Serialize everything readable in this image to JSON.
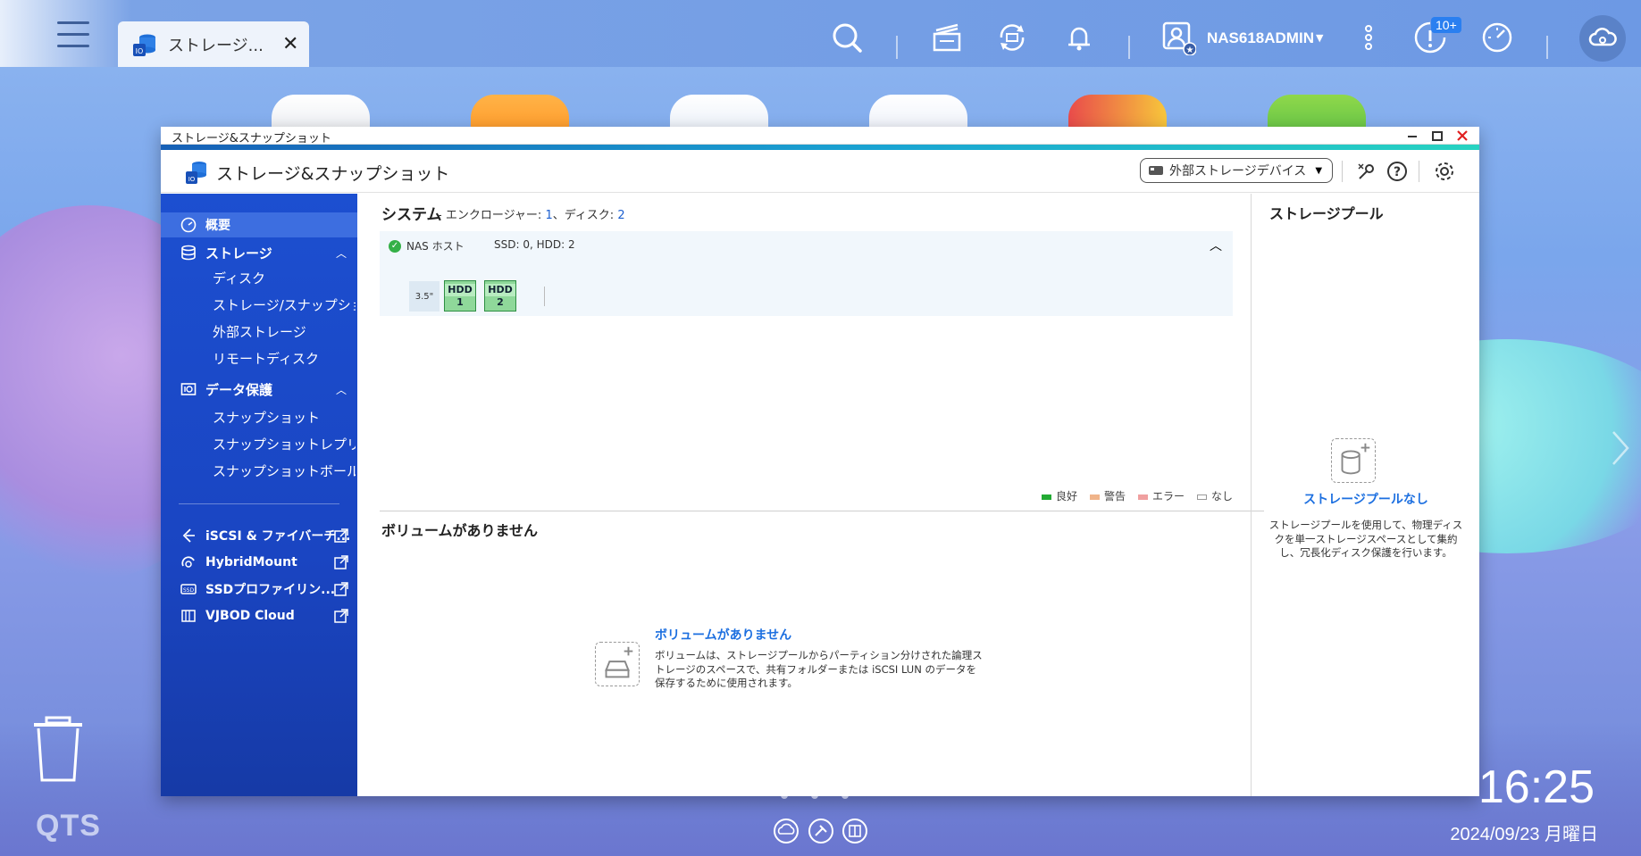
{
  "taskbar": {
    "tab_label": "ストレージ...",
    "tab_close": "✕",
    "user_name": "NAS618ADMIN",
    "notification_badge": "10+"
  },
  "window": {
    "title": "ストレージ&スナップショット",
    "app_name": "ストレージ&スナップショット",
    "external_device_dropdown": "外部ストレージデバイス"
  },
  "sidebar": {
    "overview": "概要",
    "storage": "ストレージ",
    "storage_items": [
      "ディスク",
      "ストレージ/スナップショ...",
      "外部ストレージ",
      "リモートディスク"
    ],
    "data_protection": "データ保護",
    "protection_items": [
      "スナップショット",
      "スナップショットレプリカ",
      "スナップショットボールト"
    ],
    "links": [
      "iSCSI & ファイバーチ...",
      "HybridMount",
      "SSDプロファイリン...",
      "VJBOD Cloud"
    ]
  },
  "system": {
    "title": "システム",
    "enclosure_label": " - エンクロージャー: ",
    "enclosure_count": "1",
    "disk_label": "、ディスク: ",
    "disk_count": "2",
    "host_name": "NAS ホスト",
    "host_spec": "SSD: 0, HDD: 2",
    "slot_size": "3.5\"",
    "disks": [
      {
        "type": "HDD",
        "slot": "1"
      },
      {
        "type": "HDD",
        "slot": "2"
      }
    ]
  },
  "legend": {
    "good": "良好",
    "warning": "警告",
    "error": "エラー",
    "none": "なし",
    "colors": {
      "good": "#22aa33",
      "warning": "#f0b48a",
      "error": "#f0a0a0",
      "none": "#ffffff"
    }
  },
  "volume": {
    "section_title": "ボリュームがありません",
    "empty_title": "ボリュームがありません",
    "empty_desc": "ボリュームは、ストレージプールからパーティション分けされた論理ストレージのスペースで、共有フォルダーまたは iSCSI LUN のデータを保存するために使用されます。"
  },
  "pool": {
    "section_title": "ストレージプール",
    "empty_title": "ストレージプールなし",
    "empty_desc": "ストレージプールを使用して、物理ディスクを単一ストレージスペースとして集約し、冗長化ディスク保護を行います。"
  },
  "desktop": {
    "brand": "QTS",
    "time": "16:25",
    "date": "2024/09/23 月曜日"
  }
}
